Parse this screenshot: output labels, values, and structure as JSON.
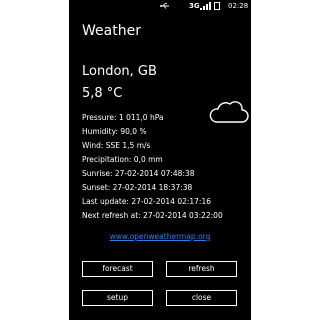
{
  "status_bar": {
    "network": "3G",
    "time": "02:28",
    "usb_icon": "usb-icon",
    "signal_icon": "signal-icon",
    "battery_icon": "battery-icon"
  },
  "app": {
    "title": "Weather"
  },
  "weather": {
    "location": "London, GB",
    "temperature": "5,8 °C",
    "condition_icon": "cloud-icon",
    "details": [
      "Pressure: 1 011,0 hPa",
      "Humidity: 90,0 %",
      "Wind: SSE 1,5 m/s",
      "Precipitation: 0,0 mm",
      "Sunrise: 27-02-2014 07:48:38",
      "Sunset: 27-02-2014 18:37:38",
      "Last update: 27-02-2014 02:17:16",
      "Next refresh at: 27-02-2014 03:22:00"
    ]
  },
  "link": {
    "text": "www.openweathermap.org"
  },
  "buttons": {
    "forecast": "forecast",
    "refresh": "refresh",
    "setup": "setup",
    "close": "close"
  },
  "colors": {
    "background": "#000000",
    "text": "#ffffff",
    "link": "#2c7fe6"
  }
}
